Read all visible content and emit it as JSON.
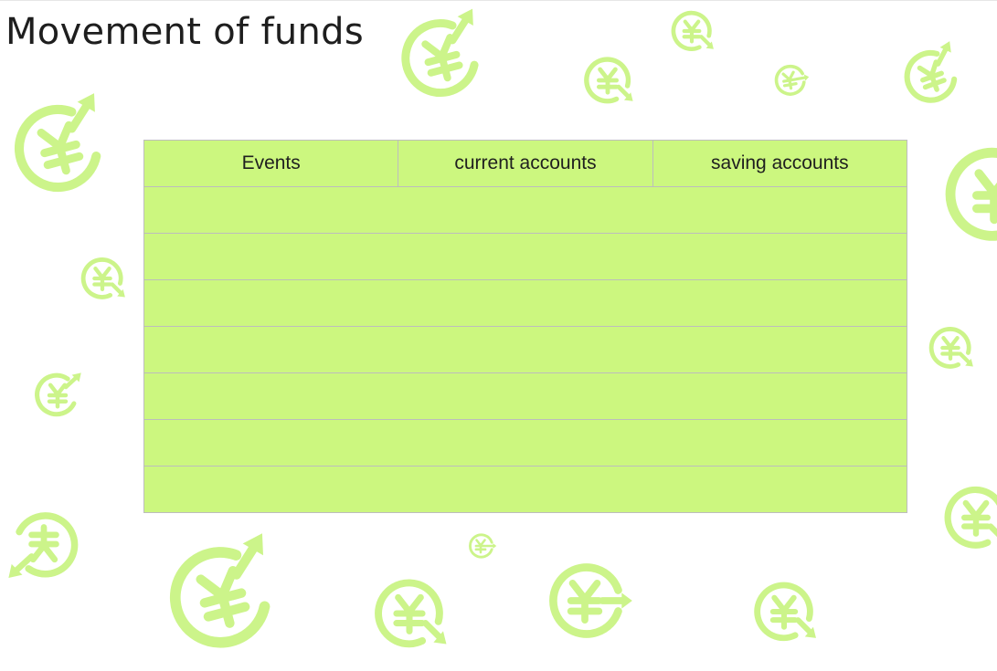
{
  "title": "Movement of funds",
  "table": {
    "headers": [
      "Events",
      "current accounts",
      "saving accounts"
    ],
    "rows": [
      [
        "",
        "",
        ""
      ],
      [
        "",
        "",
        ""
      ],
      [
        "",
        "",
        ""
      ],
      [
        "",
        "",
        ""
      ],
      [
        "",
        "",
        ""
      ],
      [
        "",
        "",
        ""
      ],
      [
        "",
        "",
        ""
      ]
    ]
  },
  "colors": {
    "table_fill": "#ccf77f",
    "grid_line": "#bdbdbd",
    "decoration": "#ccf48a",
    "title_text": "#1e1e1e"
  },
  "decoration_icon": "yen-exchange-icon"
}
